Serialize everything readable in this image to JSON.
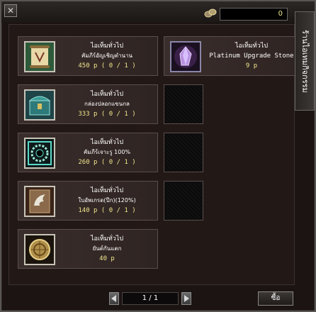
{
  "header": {
    "close_label": "✕",
    "currency_value": "0",
    "icons": {
      "close": "close-icon",
      "currency": "coin-icon"
    }
  },
  "side_tab": {
    "label": "ร้านไอเทมกิจกรรม"
  },
  "items": [
    {
      "category": "ไอเท็มทั่วไป",
      "name": "คัมภีร์อัญเชิญตำนาน",
      "price": "450 p ( 0 / 1 )",
      "icon": "scroll-icon"
    },
    {
      "category": "ไอเท็มทั่วไป",
      "name": "Platinum Upgrade Stone",
      "price": "9 p",
      "icon": "crystal-icon"
    },
    {
      "category": "ไอเท็มทั่วไป",
      "name": "กล่องปลอกแขนกล",
      "price": "333 p ( 0 / 1 )",
      "icon": "chest-icon"
    },
    {
      "category": "ไอเท็มทั่วไป",
      "name": "คัมภีร์เจาะรู 100%",
      "price": "260 p ( 0 / 1 )",
      "icon": "socket-icon"
    },
    {
      "category": "ไอเท็มทั่วไป",
      "name": "ใบอัพเกรด(ปีก)(120%)",
      "price": "140 p ( 0 / 1 )",
      "icon": "wing-scroll-icon"
    },
    {
      "category": "ไอเท็มทั่วไป",
      "name": "ยันต์กันแตก",
      "price": "40 p",
      "icon": "talisman-icon"
    }
  ],
  "pager": {
    "display": "1 / 1",
    "prev_icon": "arrow-left-icon",
    "next_icon": "arrow-right-icon"
  },
  "buy_button": {
    "label": "ซื้อ"
  }
}
